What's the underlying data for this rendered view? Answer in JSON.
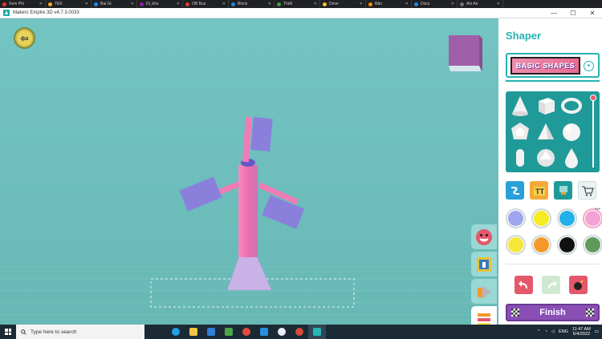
{
  "browser_tabs": [
    {
      "label": "Xem Phi",
      "color": "#e53935"
    },
    {
      "label": "TEK",
      "color": "#f9a825"
    },
    {
      "label": "Bai Gi",
      "color": "#1e88e5"
    },
    {
      "label": "Di_khu",
      "color": "#8e24aa"
    },
    {
      "label": "OB Bus",
      "color": "#e53935"
    },
    {
      "label": "Block",
      "color": "#1e88e5"
    },
    {
      "label": "Thiết",
      "color": "#43a047"
    },
    {
      "label": "Drive",
      "color": "#fbc02d"
    },
    {
      "label": "Bản",
      "color": "#fb8c00"
    },
    {
      "label": "Docs",
      "color": "#1e88e5"
    },
    {
      "label": "Alo Ao",
      "color": "#757575"
    }
  ],
  "window": {
    "title": "Makers Empire 3D v4.7.3.0033",
    "minimize": "—",
    "maximize": "☐",
    "close": "✕"
  },
  "panel": {
    "title": "Shaper",
    "shape_set": "BASIC SHAPES",
    "finish_label": "Finish"
  },
  "colors": {
    "accent": "#26b3b3",
    "swatches": [
      "#9fa4ee",
      "#f5ec21",
      "#21b0e9",
      "#f4a3d6",
      "#f6e63a",
      "#f39a2a",
      "#111111",
      "#5f9a5a"
    ]
  },
  "tools": {
    "row1": [
      "path-tool-icon",
      "text-tool-icon",
      "stamp-tool-icon",
      "shop-cart-icon"
    ],
    "row3": [
      "undo-icon",
      "redo-icon",
      "bomb-icon"
    ]
  },
  "taskbar": {
    "search_placeholder": "Type here to search",
    "lang": "ENG",
    "time": "11:47 AM",
    "date": "6/4/2022"
  }
}
